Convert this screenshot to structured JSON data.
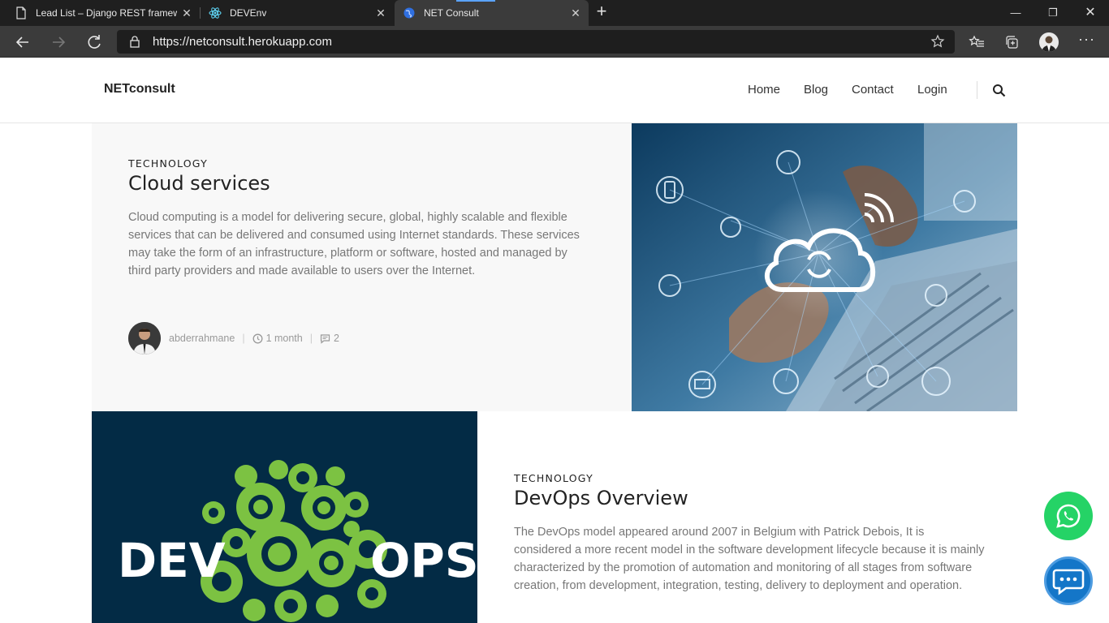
{
  "browser": {
    "tabs": [
      {
        "title": "Lead List – Django REST framewo",
        "icon": "document-icon",
        "active": false
      },
      {
        "title": "DEVEnv",
        "icon": "react-icon",
        "active": false
      },
      {
        "title": "NET Consult",
        "icon": "globe-icon",
        "active": true
      }
    ],
    "url": "https://netconsult.herokuapp.com"
  },
  "site": {
    "brand": "NETconsult",
    "menu": [
      "Home",
      "Blog",
      "Contact",
      "Login"
    ]
  },
  "posts": [
    {
      "category": "TECHNOLOGY",
      "title": "Cloud services",
      "excerpt": "Cloud computing is a model for delivering secure, global, highly scalable and flexible services that can be delivered and consumed using Internet standards. These services may take the form of an infrastructure, platform or software, hosted and managed by third party providers and made available to users over the Internet.",
      "author": "abderrahmane",
      "age": "1 month",
      "comments": "2"
    },
    {
      "category": "TECHNOLOGY",
      "title": "DevOps Overview",
      "excerpt": "The DevOps model appeared around 2007 in Belgium with Patrick Debois, It is considered a more recent model in the software development lifecycle because it is mainly characterized by the promotion of automation and monitoring of all stages from software creation, from development, integration, testing, delivery to deployment and operation.",
      "image_text_left": "DEV",
      "image_text_right": "OPS"
    }
  ],
  "colors": {
    "whatsapp": "#25d366",
    "chat": "#1476c8",
    "devops_bg": "#032b45",
    "gear_green": "#7cc242"
  }
}
